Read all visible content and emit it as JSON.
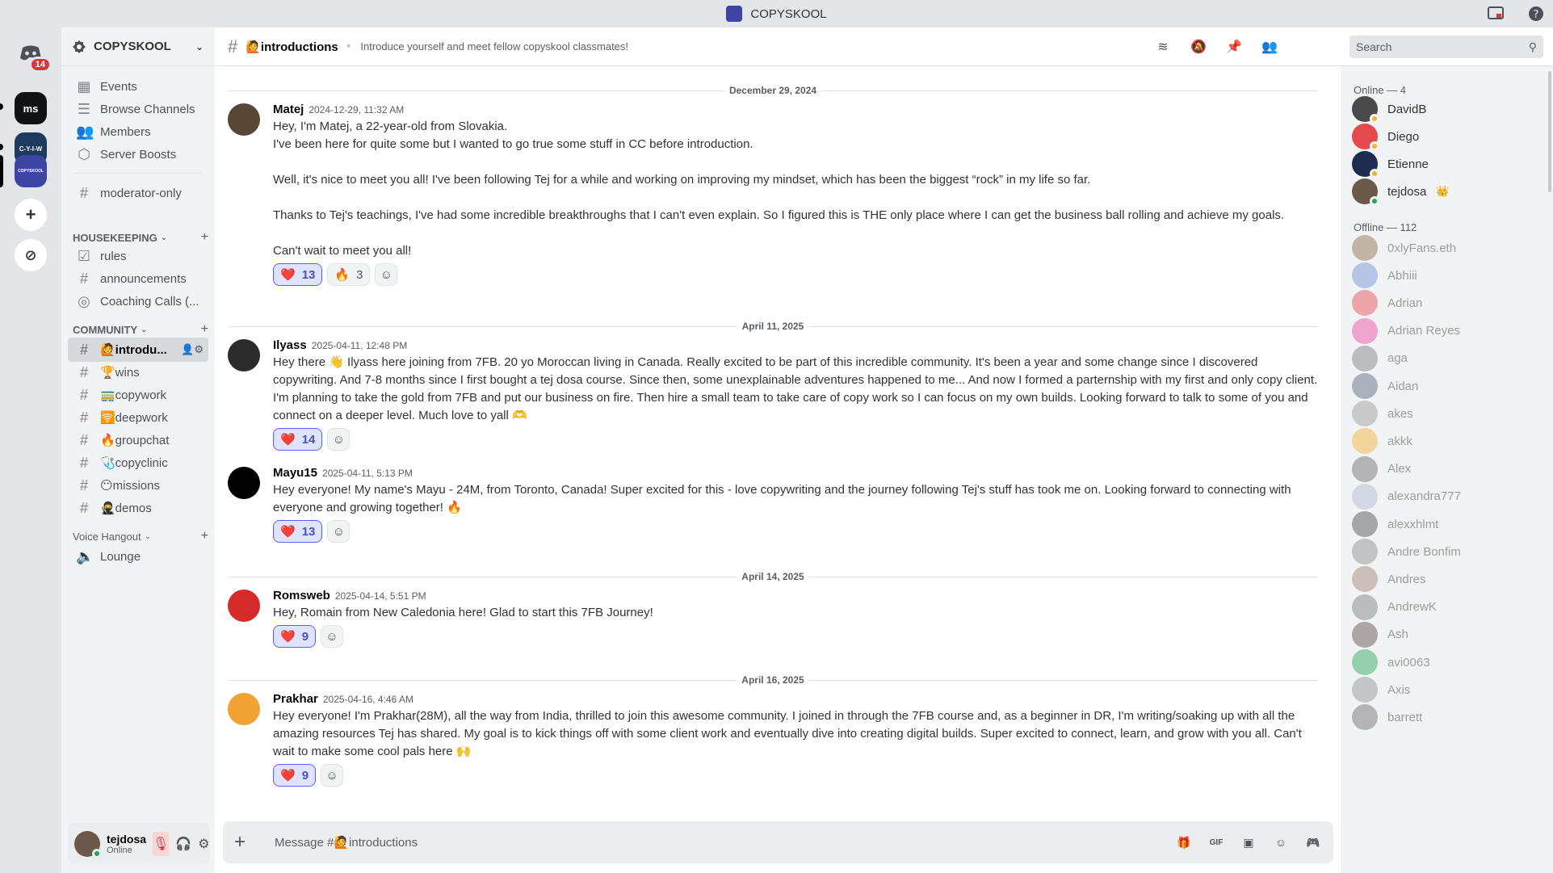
{
  "window": {
    "title": "COPYSKOOL"
  },
  "rail": {
    "dm_badge": "14",
    "servers": [
      {
        "label": "ms",
        "color": "#111214"
      },
      {
        "label": "C-Y-I-W",
        "color": "#1e3a5f"
      },
      {
        "label": "COPYSKOOL",
        "color": "#3c45a5"
      }
    ],
    "add_label": "+",
    "discover_label": "⊘"
  },
  "sidebar": {
    "guild_name": "COPYSKOOL",
    "top_items": [
      {
        "icon": "calendar-icon",
        "label": "Events"
      },
      {
        "icon": "browse-icon",
        "label": "Browse Channels"
      },
      {
        "icon": "members-icon",
        "label": "Members"
      },
      {
        "icon": "boost-icon",
        "label": "Server Boosts"
      }
    ],
    "moderator": "moderator-only",
    "cat_housekeeping": "HOUSEKEEPING",
    "housekeeping": [
      {
        "icon": "rules-icon",
        "label": "rules"
      },
      {
        "icon": "hash-icon",
        "label": "announcements"
      },
      {
        "icon": "stage-icon",
        "label": "Coaching Calls (..."
      }
    ],
    "cat_community": "COMMUNITY",
    "community": [
      {
        "label": "🙋introdu...",
        "active": true
      },
      {
        "label": "🏆wins"
      },
      {
        "label": "🚃copywork"
      },
      {
        "label": "🛜deepwork"
      },
      {
        "label": "🔥groupchat"
      },
      {
        "label": "🩺copyclinic"
      },
      {
        "label": "😶missions"
      },
      {
        "label": "🥷demos"
      }
    ],
    "cat_voice": "Voice Hangout",
    "voice": [
      {
        "label": "Lounge"
      }
    ]
  },
  "user": {
    "name": "tejdosa",
    "status": "Online"
  },
  "header": {
    "channel": "🙋introductions",
    "topic": "Introduce yourself and meet fellow copyskool classmates!",
    "search_placeholder": "Search"
  },
  "messages": {
    "dates": [
      "December 29, 2024",
      "April 11, 2025",
      "April 14, 2025",
      "April 16, 2025"
    ],
    "list": [
      {
        "author": "Matej",
        "ts": "2024-12-29, 11:32 AM",
        "avatar_color": "#5a4634",
        "body": "Hey, I'm Matej, a 22-year-old from Slovakia.\nI've been here for quite some but I wanted to go true some stuff in CC before introduction.\n\nWell, it's nice to meet you all! I've been following Tej for a while and working on improving my mindset, which has been the biggest “rock” in my life so far.\n\nThanks to Tej's teachings, I've had some incredible breakthroughs that I can't even explain. So I figured this is THE only place where I can get the business ball rolling and achieve my goals.\n\nCan't wait to meet you all!",
        "reactions": [
          {
            "emoji": "❤️",
            "count": "13",
            "mine": true
          },
          {
            "emoji": "🔥",
            "count": "3",
            "mine": false
          }
        ]
      },
      {
        "author": "Ilyass",
        "ts": "2025-04-11, 12:48 PM",
        "avatar_color": "#2b2b2b",
        "body": "Hey there 👋 Ilyass here joining from 7FB. 20 yo Moroccan living in Canada. Really excited to be part of this incredible community. It's been a year and some change since I discovered copywriting. And 7-8 months since I first bought a tej dosa course. Since then, some unexplainable adventures happened to me... And now I formed a parternship with my first and only copy client. I'm planning to take the gold from 7FB and put our business on fire. Then hire a small team to take care of copy work so I can focus on my own builds. Looking forward to talk to some of you and connect on a deeper level. Much love to yall 🫶",
        "reactions": [
          {
            "emoji": "❤️",
            "count": "14",
            "mine": true
          }
        ]
      },
      {
        "author": "Mayu15",
        "ts": "2025-04-11, 5:13 PM",
        "avatar_color": "#000000",
        "body": "Hey everyone! My name's Mayu - 24M, from Toronto, Canada! Super excited for this - love copywriting and the journey following Tej's stuff has took me on. Looking forward to connecting with everyone and growing together! 🔥",
        "reactions": [
          {
            "emoji": "❤️",
            "count": "13",
            "mine": true
          }
        ]
      },
      {
        "author": "Romsweb",
        "ts": "2025-04-14, 5:51 PM",
        "avatar_color": "#d62b2b",
        "body": "Hey, Romain from New Caledonia here! Glad to start this 7FB Journey!",
        "reactions": [
          {
            "emoji": "❤️",
            "count": "9",
            "mine": true
          }
        ]
      },
      {
        "author": "Prakhar",
        "ts": "2025-04-16, 4:46 AM",
        "avatar_color": "#f0a232",
        "body": "Hey everyone! I'm Prakhar(28M), all the way from India, thrilled to join this awesome community. I joined in through the 7FB course and, as a beginner in DR, I'm writing/soaking up with all the amazing resources Tej has shared. My goal is to kick things off with some client work and eventually dive into creating digital builds. Super excited to connect, learn, and grow with you all. Can't wait to make some cool pals here 🙌",
        "reactions": [
          {
            "emoji": "❤️",
            "count": "9",
            "mine": true
          }
        ]
      }
    ]
  },
  "composer": {
    "placeholder": "Message #🙋introductions"
  },
  "members": {
    "online_label": "Online — 4",
    "offline_label": "Offline — 112",
    "online": [
      {
        "name": "DavidB",
        "color": "#4a4a4a"
      },
      {
        "name": "Diego",
        "color": "#e5484d"
      },
      {
        "name": "Etienne",
        "color": "#1d2b4f"
      },
      {
        "name": "tejdosa",
        "color": "#6b5a4a",
        "badge": "👑"
      }
    ],
    "offline": [
      {
        "name": "0xlyFans.eth",
        "color": "#8a6a4a"
      },
      {
        "name": "Abhiii",
        "color": "#6f8fd6"
      },
      {
        "name": "Adrian",
        "color": "#e5484d"
      },
      {
        "name": "Adrian Reyes",
        "color": "#eb459e"
      },
      {
        "name": "aga",
        "color": "#7a7a7a"
      },
      {
        "name": "Aidan",
        "color": "#55607a"
      },
      {
        "name": "akes",
        "color": "#9a9a9a"
      },
      {
        "name": "akkk",
        "color": "#f0b232"
      },
      {
        "name": "Alex",
        "color": "#6a6a6a"
      },
      {
        "name": "alexandra777",
        "color": "#b0b8d0"
      },
      {
        "name": "alexxhlmt",
        "color": "#4a4a4a"
      },
      {
        "name": "Andre Bonfim",
        "color": "#8a8a8a"
      },
      {
        "name": "Andres",
        "color": "#a08070"
      },
      {
        "name": "AndrewK",
        "color": "#7a7a7a"
      },
      {
        "name": "Ash",
        "color": "#5a4a4a"
      },
      {
        "name": "avi0063",
        "color": "#23a559"
      },
      {
        "name": "Axis",
        "color": "#909090"
      },
      {
        "name": "barrett",
        "color": "#6a6a6a"
      }
    ]
  }
}
